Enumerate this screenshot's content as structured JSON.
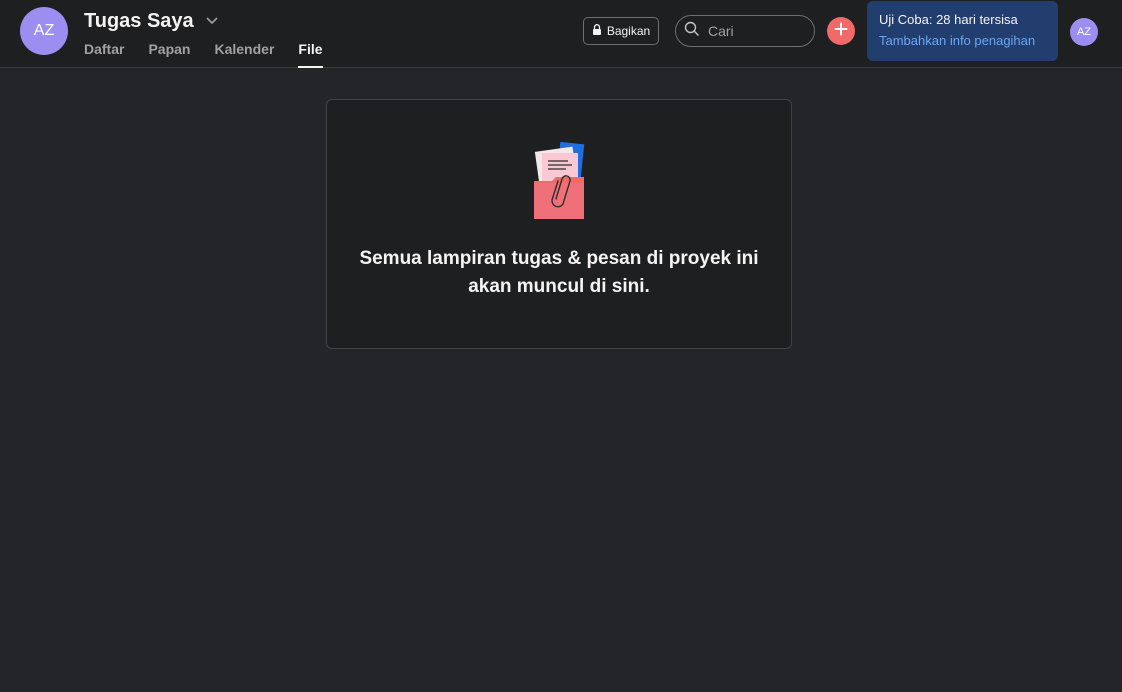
{
  "project": {
    "avatar_initials": "AZ",
    "title": "Tugas Saya"
  },
  "tabs": [
    {
      "label": "Daftar",
      "active": false
    },
    {
      "label": "Papan",
      "active": false
    },
    {
      "label": "Kalender",
      "active": false
    },
    {
      "label": "File",
      "active": true
    }
  ],
  "toolbar": {
    "share_label": "Bagikan",
    "search_placeholder": "Cari"
  },
  "trial": {
    "text": "Uji Coba: 28 hari tersisa",
    "link": "Tambahkan info penagihan"
  },
  "user": {
    "avatar_initials": "AZ"
  },
  "empty_state": {
    "message_line1": "Semua lampiran tugas & pesan di proyek ini",
    "message_line2": "akan muncul di sini."
  },
  "colors": {
    "background": "#242528",
    "topbar": "#1e1f21",
    "avatar": "#9b8ef0",
    "add_button": "#f06a6a",
    "trial_banner": "#213e6f",
    "link": "#6ca6f5"
  },
  "icons": [
    "chevron-down-icon",
    "lock-icon",
    "search-icon",
    "plus-icon",
    "attachment-folder-illustration"
  ]
}
